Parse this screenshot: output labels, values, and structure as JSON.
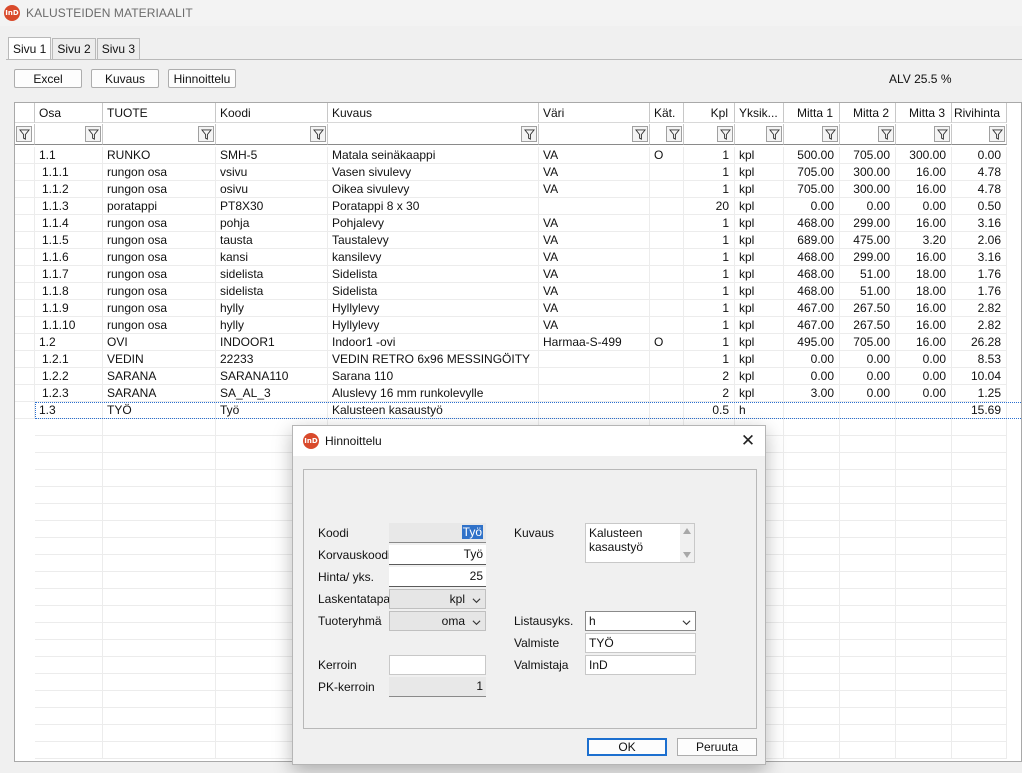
{
  "app": {
    "title": "KALUSTEIDEN MATERIAALIT",
    "logo_text": "InD"
  },
  "tabs": [
    {
      "label": "Sivu 1",
      "active": true
    },
    {
      "label": "Sivu 2",
      "active": false
    },
    {
      "label": "Sivu 3",
      "active": false
    }
  ],
  "toolbar": {
    "excel_label": "Excel",
    "kuvaus_label": "Kuvaus",
    "hinnoittelu_label": "Hinnoittelu",
    "alv_text": "ALV 25.5 %"
  },
  "grid": {
    "columns": [
      "Osa",
      "TUOTE",
      "Koodi",
      "Kuvaus",
      "Väri",
      "Kät.",
      "Kpl",
      "Yksik...",
      "Mitta 1",
      "Mitta 2",
      "Mitta 3",
      "Rivihinta"
    ],
    "rows": [
      [
        "1.1",
        "RUNKO",
        "SMH-5",
        "Matala seinäkaappi",
        "VA",
        "O",
        "1",
        "kpl",
        "500.00",
        "705.00",
        "300.00",
        "0.00"
      ],
      [
        "1.1.1",
        "rungon osa",
        "vsivu",
        "Vasen sivulevy",
        "VA",
        "",
        "1",
        "kpl",
        "705.00",
        "300.00",
        "16.00",
        "4.78"
      ],
      [
        "1.1.2",
        "rungon osa",
        "osivu",
        "Oikea sivulevy",
        "VA",
        "",
        "1",
        "kpl",
        "705.00",
        "300.00",
        "16.00",
        "4.78"
      ],
      [
        "1.1.3",
        "poratappi",
        "PT8X30",
        "Poratappi 8 x 30",
        "",
        "",
        "20",
        "kpl",
        "0.00",
        "0.00",
        "0.00",
        "0.50"
      ],
      [
        "1.1.4",
        "rungon osa",
        "pohja",
        "Pohjalevy",
        "VA",
        "",
        "1",
        "kpl",
        "468.00",
        "299.00",
        "16.00",
        "3.16"
      ],
      [
        "1.1.5",
        "rungon osa",
        "tausta",
        "Taustalevy",
        "VA",
        "",
        "1",
        "kpl",
        "689.00",
        "475.00",
        "3.20",
        "2.06"
      ],
      [
        "1.1.6",
        "rungon osa",
        "kansi",
        "kansilevy",
        "VA",
        "",
        "1",
        "kpl",
        "468.00",
        "299.00",
        "16.00",
        "3.16"
      ],
      [
        "1.1.7",
        "rungon osa",
        "sidelista",
        "Sidelista",
        "VA",
        "",
        "1",
        "kpl",
        "468.00",
        "51.00",
        "18.00",
        "1.76"
      ],
      [
        "1.1.8",
        "rungon osa",
        "sidelista",
        "Sidelista",
        "VA",
        "",
        "1",
        "kpl",
        "468.00",
        "51.00",
        "18.00",
        "1.76"
      ],
      [
        "1.1.9",
        "rungon osa",
        "hylly",
        "Hyllylevy",
        "VA",
        "",
        "1",
        "kpl",
        "467.00",
        "267.50",
        "16.00",
        "2.82"
      ],
      [
        "1.1.10",
        "rungon osa",
        "hylly",
        "Hyllylevy",
        "VA",
        "",
        "1",
        "kpl",
        "467.00",
        "267.50",
        "16.00",
        "2.82"
      ],
      [
        "1.2",
        "OVI",
        "INDOOR1",
        "Indoor1 -ovi",
        "Harmaa-S-499",
        "O",
        "1",
        "kpl",
        "495.00",
        "705.00",
        "16.00",
        "26.28"
      ],
      [
        "1.2.1",
        "VEDIN",
        "22233",
        "VEDIN RETRO 6x96 MESSINGÖITY",
        "",
        "",
        "1",
        "kpl",
        "0.00",
        "0.00",
        "0.00",
        "8.53"
      ],
      [
        "1.2.2",
        "SARANA",
        "SARANA110",
        "Sarana 110",
        "",
        "",
        "2",
        "kpl",
        "0.00",
        "0.00",
        "0.00",
        "10.04"
      ],
      [
        "1.2.3",
        "SARANA",
        "SA_AL_3",
        "Aluslevy 16 mm runkolevylle",
        "",
        "",
        "2",
        "kpl",
        "3.00",
        "0.00",
        "0.00",
        "1.25"
      ],
      [
        "1.3",
        "TYÖ",
        "Työ",
        "Kalusteen kasaustyö",
        "",
        "",
        "0.5",
        "h",
        "",
        "",
        "",
        "15.69"
      ]
    ],
    "selected_row": 15
  },
  "dialog": {
    "title": "Hinnoittelu",
    "close_glyph": "✕",
    "labels": {
      "koodi": "Koodi",
      "korvauskoodi": "Korvauskoodi",
      "hinta": "Hinta/ yks.",
      "laskentatapa": "Laskentatapa",
      "tuoteryhma": "Tuoteryhmä",
      "kerroin": "Kerroin",
      "pk_kerroin": "PK-kerroin",
      "kuvaus": "Kuvaus",
      "listausyks": "Listausyks.",
      "valmiste": "Valmiste",
      "valmistaja": "Valmistaja"
    },
    "values": {
      "koodi": "Työ",
      "korvauskoodi": "Työ",
      "hinta": "25",
      "laskentatapa": "kpl",
      "tuoteryhma": "oma",
      "kerroin": "",
      "pk_kerroin": "1",
      "kuvaus_line1": "Kalusteen",
      "kuvaus_line2": "kasaustyö",
      "listausyks": "h",
      "valmiste": "TYÖ",
      "valmistaja": "InD"
    },
    "ok_label": "OK",
    "cancel_label": "Peruuta"
  },
  "colors": {
    "accent": "#1c6fcf",
    "logo": "#d94a2b",
    "selection": "#3072c9"
  }
}
